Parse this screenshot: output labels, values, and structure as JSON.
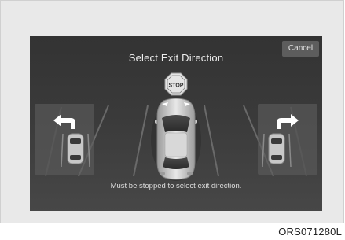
{
  "screen": {
    "title": "Select Exit Direction",
    "cancel_label": "Cancel",
    "stop_sign_text": "STOP",
    "message": "Must be stopped to select exit direction."
  },
  "figure_code": "ORS071280L",
  "icons": {
    "left_option": "left-exit-car-icon",
    "right_option": "right-exit-car-icon",
    "center_car": "car-top-view-icon",
    "stop": "stop-sign-icon"
  },
  "colors": {
    "screen_background": "#3c3c3c",
    "button_background": "#5d5d5d",
    "text": "#eeeeee"
  }
}
